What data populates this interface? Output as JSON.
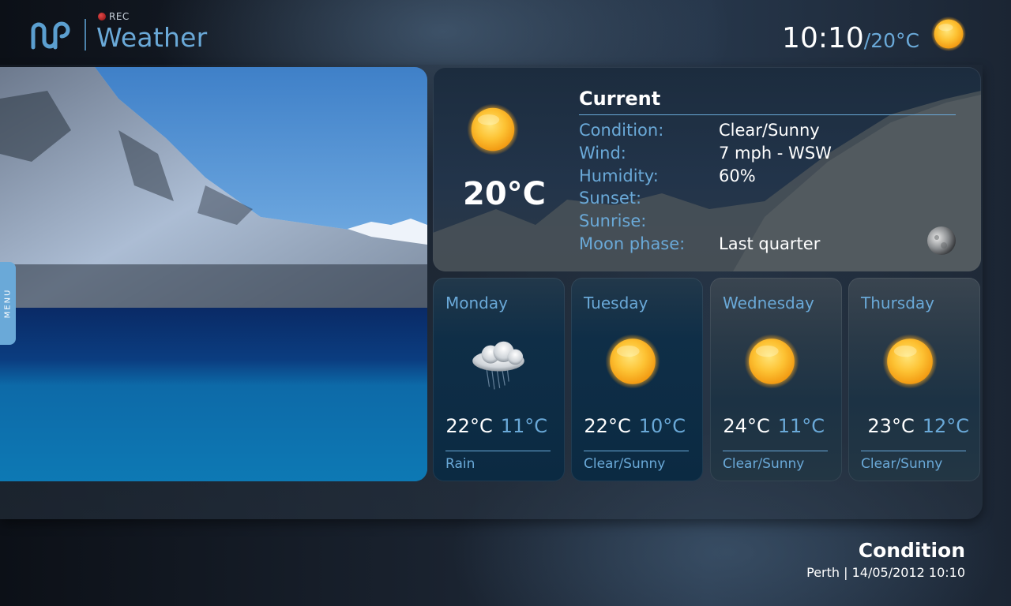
{
  "header": {
    "rec_label": "REC",
    "app_title": "Weather",
    "logo": "mp-logo-icon",
    "clock": {
      "time": "10:10",
      "temp": "/20°C",
      "icon": "sun-icon"
    }
  },
  "side_menu": {
    "label": "MENU"
  },
  "current": {
    "title": "Current",
    "temp": "20°C",
    "icon": "sun-icon",
    "rows": [
      {
        "label": "Condition:",
        "value": "Clear/Sunny"
      },
      {
        "label": "Wind:",
        "value": "7 mph - WSW"
      },
      {
        "label": "Humidity:",
        "value": "60%"
      },
      {
        "label": "Sunset:",
        "value": ""
      },
      {
        "label": "Sunrise:",
        "value": ""
      },
      {
        "label": "Moon phase:",
        "value": "Last quarter"
      }
    ],
    "moon_icon": "moon-icon"
  },
  "forecast": [
    {
      "day": "Monday",
      "high": "22°C",
      "low": "11°C",
      "condition": "Rain",
      "icon": "rain-cloud-icon"
    },
    {
      "day": "Tuesday",
      "high": "22°C",
      "low": "10°C",
      "condition": "Clear/Sunny",
      "icon": "sun-icon"
    },
    {
      "day": "Wednesday",
      "high": "24°C",
      "low": "11°C",
      "condition": "Clear/Sunny",
      "icon": "sun-icon"
    },
    {
      "day": "Thursday",
      "high": "23°C",
      "low": "12°C",
      "condition": "Clear/Sunny",
      "icon": "sun-icon"
    }
  ],
  "footer": {
    "title": "Condition",
    "subtitle": "Perth | 14/05/2012 10:10"
  },
  "colors": {
    "accent": "#6aa9d8",
    "text": "#ffffff",
    "sun": "#f7b52a"
  }
}
